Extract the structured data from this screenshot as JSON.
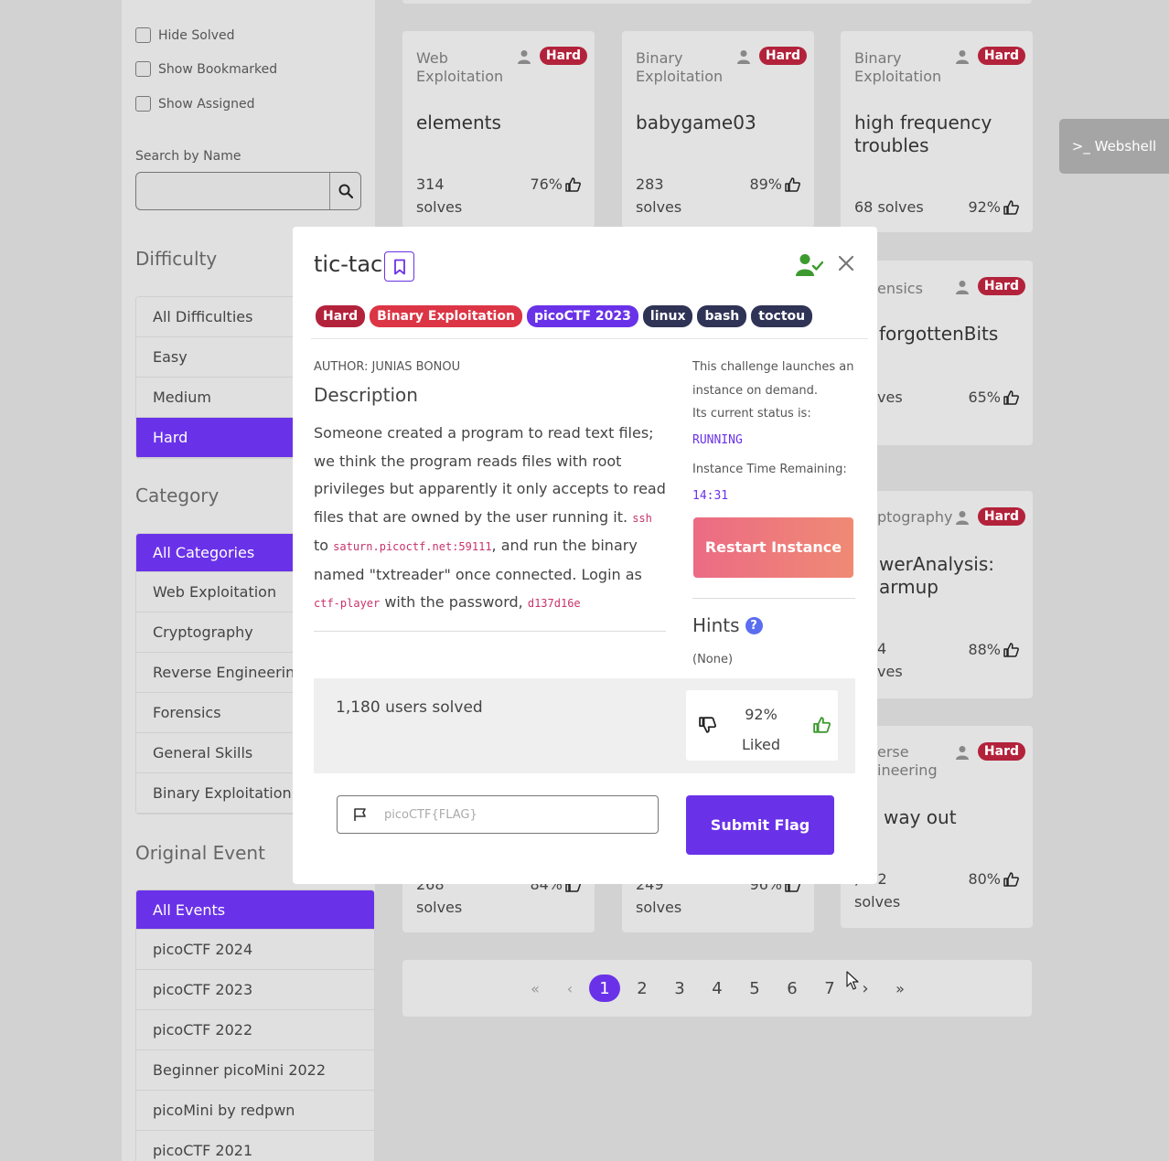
{
  "filters": {
    "hide_solved": "Hide Solved",
    "show_bookmarked": "Show Bookmarked",
    "show_assigned": "Show Assigned",
    "search_label": "Search by Name"
  },
  "difficulty": {
    "title": "Difficulty",
    "items": [
      "All Difficulties",
      "Easy",
      "Medium",
      "Hard"
    ],
    "selected": "Hard"
  },
  "category": {
    "title": "Category",
    "items": [
      "All Categories",
      "Web Exploitation",
      "Cryptography",
      "Reverse Engineering",
      "Forensics",
      "General Skills",
      "Binary Exploitation"
    ],
    "selected": "All Categories"
  },
  "event": {
    "title": "Original Event",
    "items": [
      "All Events",
      "picoCTF 2024",
      "picoCTF 2023",
      "picoCTF 2022",
      "Beginner picoMini 2022",
      "picoMini by redpwn",
      "picoCTF 2021"
    ],
    "selected": "All Events"
  },
  "cards": [
    {
      "category": "Web Exploitation",
      "difficulty": "Hard",
      "name": "elements",
      "solves_num": "314",
      "solves_word": "solves",
      "liked": "76%"
    },
    {
      "category": "Binary Exploitation",
      "difficulty": "Hard",
      "name": "babygame03",
      "solves_num": "283",
      "solves_word": "solves",
      "liked": "89%"
    },
    {
      "category": "Binary Exploitation",
      "difficulty": "Hard",
      "name": "high frequency troubles",
      "solves": "68 solves",
      "liked": "92%"
    },
    {
      "category": "ensics",
      "difficulty": "Hard",
      "name": "forgottenBits",
      "solves_num": "",
      "solves_word": "ves",
      "liked": "65%"
    },
    {
      "category": "ptography",
      "difficulty": "Hard",
      "name_line1": "werAnalysis:",
      "name_line2": "armup",
      "solves_num": "4",
      "solves_word": "ves",
      "liked": "88%"
    },
    {
      "category_line1": "erse",
      "category_line2": "ineering",
      "difficulty": "Hard",
      "name": "way out",
      "solves_num": ",262",
      "solves_word": "solves",
      "liked": "80%"
    },
    {
      "solves_num": "268",
      "solves_word": "solves",
      "liked": "84%"
    },
    {
      "solves_num": "249",
      "solves_word": "solves",
      "liked": "96%"
    }
  ],
  "pagination": {
    "first": "«",
    "prev": "‹",
    "next": "›",
    "last": "»",
    "pages": [
      "1",
      "2",
      "3",
      "4",
      "5",
      "6",
      "7"
    ],
    "current": "1"
  },
  "webshell": {
    "label": ">_ Webshell"
  },
  "modal": {
    "title": "tic-tac",
    "tags": [
      {
        "label": "Hard",
        "color": "#b3223b"
      },
      {
        "label": "Binary Exploitation",
        "color": "#dc3545"
      },
      {
        "label": "picoCTF 2023",
        "color": "#6a32e8"
      },
      {
        "label": "linux",
        "color": "#2f3355"
      },
      {
        "label": "bash",
        "color": "#2f3355"
      },
      {
        "label": "toctou",
        "color": "#2f3355"
      }
    ],
    "author": "AUTHOR: JUNIAS BONOU",
    "description_heading": "Description",
    "description_text": "Someone created a program to read text files; we think the program reads files with root privileges but apparently it only accepts to read files that are owned by the user running it.",
    "ssh_cmd": "ssh",
    "to_word": " to ",
    "host": "saturn.picoctf.net:59111",
    "after_host": ", and run the binary named \"txtreader\" once connected. Login as ",
    "user": "ctf-player",
    "with_password": " with the password, ",
    "password": "d137d16e",
    "instance_info_1": "This challenge launches an instance on demand.",
    "instance_info_2": "Its current status is:",
    "status": "RUNNING",
    "time_label": "Instance Time Remaining:",
    "time_value": "14:31",
    "restart_label": "Restart Instance",
    "hints_heading": "Hints",
    "hints_value": "(None)",
    "users_solved": "1,180 users solved",
    "liked_pct": "92%",
    "liked_word": "Liked",
    "flag_placeholder": "picoCTF{FLAG}",
    "submit_label": "Submit Flag"
  }
}
